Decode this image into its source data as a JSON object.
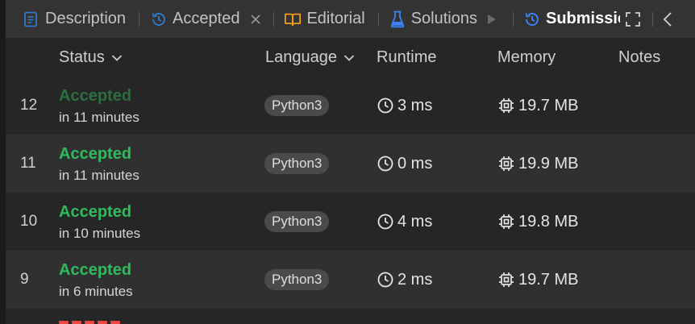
{
  "tabs": {
    "description": "Description",
    "accepted": "Accepted",
    "editorial": "Editorial",
    "solutions": "Solutions",
    "submissions": "Submissions"
  },
  "table": {
    "headers": {
      "status": "Status",
      "language": "Language",
      "runtime": "Runtime",
      "memory": "Memory",
      "notes": "Notes"
    },
    "rows": [
      {
        "num": "12",
        "status": "Accepted",
        "time": "in 11 minutes",
        "language": "Python3",
        "runtime": "3 ms",
        "memory": "19.7 MB"
      },
      {
        "num": "11",
        "status": "Accepted",
        "time": "in 11 minutes",
        "language": "Python3",
        "runtime": "0 ms",
        "memory": "19.9 MB"
      },
      {
        "num": "10",
        "status": "Accepted",
        "time": "in 10 minutes",
        "language": "Python3",
        "runtime": "4 ms",
        "memory": "19.8 MB"
      },
      {
        "num": "9",
        "status": "Accepted",
        "time": "in 6 minutes",
        "language": "Python3",
        "runtime": "2 ms",
        "memory": "19.7 MB"
      }
    ]
  },
  "colors": {
    "accepted": "#2cbb5d",
    "accepted_dim": "#2a6f3e",
    "wrong_answer": "#ef4743",
    "tab_active_icon": "#3b82f6",
    "description_icon": "#2f79c9",
    "editorial_icon": "#ffa116",
    "solutions_icon": "#3b82f6"
  },
  "icons": {
    "description": "document-icon",
    "accepted": "history-icon",
    "close": "close-icon",
    "editorial": "book-icon",
    "solutions": "flask-icon",
    "play": "play-icon",
    "submissions": "history-icon",
    "expand": "expand-icon",
    "collapse": "chevron-left-icon",
    "runtime": "clock-icon",
    "memory": "chip-icon",
    "sort": "chevron-down-icon"
  }
}
